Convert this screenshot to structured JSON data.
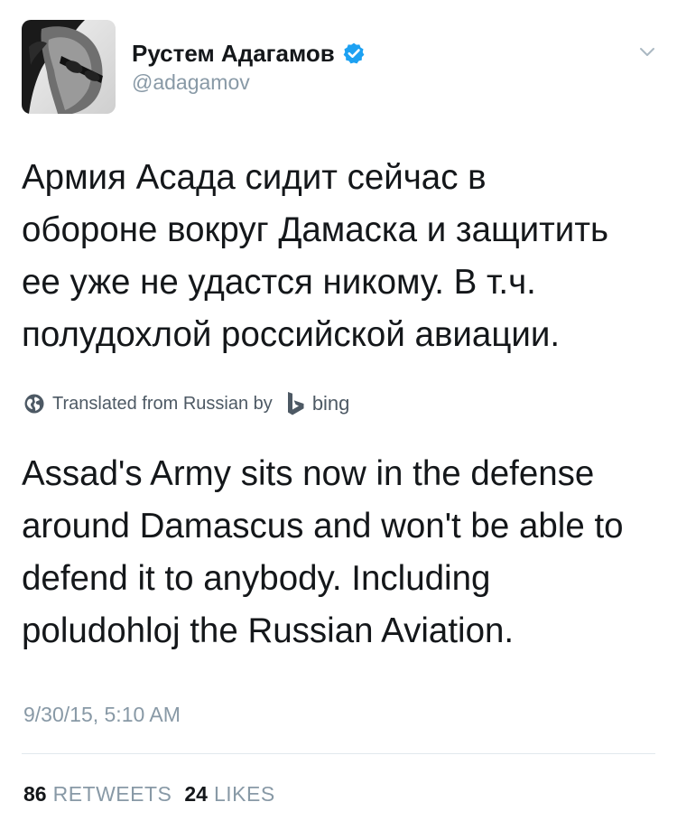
{
  "author": {
    "display_name": "Рустем Адагамов",
    "handle": "@adagamov",
    "verified": true
  },
  "tweet": {
    "original_text": "Армия Асада сидит сейчас в\nобороне вокруг Дамаска и защитить\nее уже не удастся никому. В т.ч.\nполудохлой российской авиации.",
    "translation_label": "Translated from Russian by",
    "translation_provider": "bing",
    "translated_text": "Assad's Army sits now in the defense\naround Damascus and won't be able to\ndefend it to anybody. Including\npoludohloj the Russian Aviation.",
    "timestamp": "9/30/15, 5:10 AM"
  },
  "stats": {
    "retweets_count": "86",
    "retweets_label": "RETWEETS",
    "likes_count": "24",
    "likes_label": "LIKES"
  },
  "colors": {
    "verified_badge": "#1da1f2",
    "secondary_text": "#8899a6",
    "divider": "#e1e8ed"
  },
  "icons": {
    "verified": "verified-badge-icon",
    "menu": "chevron-down-icon",
    "translation": "globe-icon",
    "provider": "bing-logo-icon"
  }
}
